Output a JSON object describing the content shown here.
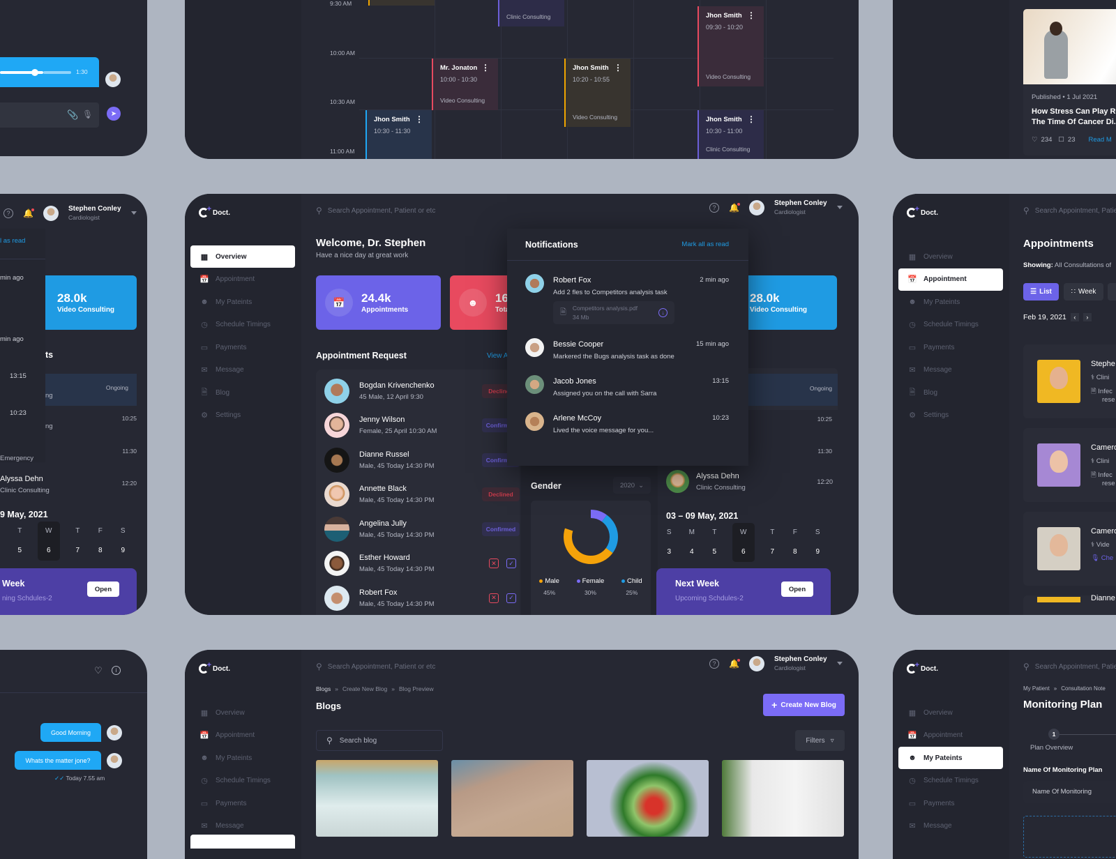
{
  "app": {
    "brand": "Doct."
  },
  "common": {
    "search_placeholder": "Search Appointment, Patient or etc",
    "user_name": "Stephen Conley",
    "user_role": "Cardiologist",
    "nav": [
      "Overview",
      "Appointment",
      "My Pateints",
      "Schedule Timings",
      "Payments",
      "Message",
      "Blog",
      "Settings"
    ]
  },
  "colors": {
    "accent": "#6c63e8",
    "danger": "#e84a5f",
    "info": "#1f9be3",
    "panel": "#262833"
  },
  "schedule_panel": {
    "time_labels": [
      "9:30 AM",
      "10:00 AM",
      "10:30 AM",
      "11:00 AM"
    ],
    "events": [
      {
        "name": "",
        "time": "",
        "kind": "Clinic Consulting",
        "color": "#6c5fd8"
      },
      {
        "name": "Mr. Jonaton",
        "time": "10:00 - 10:30",
        "kind": "Video Consulting",
        "color": "#e84a5f"
      },
      {
        "name": "Jhon Smith",
        "time": "10:20 - 10:55",
        "kind": "Video Consulting",
        "color": "#f0a500"
      },
      {
        "name": "Jhon Smith",
        "time": "09:30 - 10:20",
        "kind": "Video Consulting",
        "color": "#e84a5f"
      },
      {
        "name": "Jhon Smith",
        "time": "10:30 - 11:30",
        "kind": "",
        "color": "#1fa8f5"
      },
      {
        "name": "Jhon Smith",
        "time": "10:30 - 11:00",
        "kind": "Clinic Consulting",
        "color": "#6c5fd8"
      }
    ]
  },
  "chat_top": {
    "audio_duration": "1:30",
    "audio_progress": 0.33
  },
  "blog_card": {
    "published": "Published • 1 Jul 2021",
    "title_line1": "How Stress Can Play Ro",
    "title_line2": "The Time Of Cancer Di.",
    "likes": "234",
    "comments": "23",
    "read_more": "Read M"
  },
  "overview": {
    "welcome": "Welcome, Dr. Stephen",
    "subtitle": "Have a nice day at great work",
    "stats": [
      {
        "value": "24.4k",
        "label": "Appointments",
        "color": "#6c63e8",
        "icon": "calendar-icon"
      },
      {
        "value": "16",
        "label": "Tota",
        "color": "#e84a5f",
        "icon": "user-icon"
      },
      {
        "value": "28.0k",
        "label": "Video Consulting",
        "color": "#1f9be3",
        "icon": "video-icon"
      }
    ],
    "appointment_request": {
      "title": "Appointment Request",
      "view_all": "View A",
      "items": [
        {
          "name": "Bogdan Krivenchenko",
          "sub": "45 Male, 12 April 9:30",
          "status": "Declined"
        },
        {
          "name": "Jenny Wilson",
          "sub": "Female, 25 April 10:30 AM",
          "status": "Confirmed"
        },
        {
          "name": "Dianne Russel",
          "sub": "Male, 45 Today 14:30 PM",
          "status": "Confirmed"
        },
        {
          "name": "Annette Black",
          "sub": "Male, 45 Today 14:30 PM",
          "status": "Declined"
        },
        {
          "name": "Angelina Jully",
          "sub": "Male, 45 Today 14:30 PM",
          "status": "Confirmed"
        },
        {
          "name": "Esther Howard",
          "sub": "Male, 45 Today 14:30 PM",
          "status": "pending"
        },
        {
          "name": "Robert Fox",
          "sub": "Male, 45 Today 14:30 PM",
          "status": "pending"
        }
      ]
    },
    "notifications": {
      "title": "Notifications",
      "mark_all": "Mark all as read",
      "items": [
        {
          "name": "Robert Fox",
          "text": "Add 2 fles to Competitors analysis task",
          "time": "2 min ago",
          "file": {
            "name": "Competitors analysis.pdf",
            "size": "34 Mb"
          }
        },
        {
          "name": "Bessie Cooper",
          "text": "Markered the Bugs analysis task as done",
          "time": "15 min ago"
        },
        {
          "name": "Jacob Jones",
          "text": "Assigned you on the call with Sarra",
          "time": "13:15"
        },
        {
          "name": "Arlene McCoy",
          "text": "Lived the voice message for you...",
          "time": "10:23"
        }
      ]
    },
    "gender": {
      "title": "Gender",
      "year": "2020"
    },
    "upcoming": {
      "title_fragment": "ts",
      "items": [
        {
          "name": "",
          "sub": "ng",
          "time": "Ongoing"
        },
        {
          "name": "",
          "sub": "ng",
          "time": "10:25"
        },
        {
          "name": "",
          "sub": "Emergency",
          "time": "11:30"
        },
        {
          "name": "Alyssa Dehn",
          "sub": "Clinic Consulting",
          "time": "12:20"
        }
      ]
    },
    "week": {
      "range": "03 – 09 May, 2021",
      "days": [
        {
          "d": "S",
          "n": "3"
        },
        {
          "d": "M",
          "n": "4"
        },
        {
          "d": "T",
          "n": "5"
        },
        {
          "d": "W",
          "n": "6"
        },
        {
          "d": "T",
          "n": "7"
        },
        {
          "d": "F",
          "n": "8"
        },
        {
          "d": "S",
          "n": "9"
        }
      ],
      "selected_index": 3
    },
    "next_week": {
      "title": "Next Week",
      "subtitle": "Upcoming Schdules-2",
      "button": "Open"
    }
  },
  "chart_data": {
    "type": "pie",
    "title": "Gender",
    "categories": [
      "Male",
      "Female",
      "Child"
    ],
    "values": [
      45,
      30,
      25
    ],
    "labels": [
      "45%",
      "30%",
      "25%"
    ],
    "colors": [
      "#f5a30a",
      "#7b6cf6",
      "#1f9be3"
    ],
    "donut": true,
    "legend": "bottom"
  },
  "left_middle": {
    "video_value": "28.0k",
    "video_label": "Video Consulting",
    "mark": "l as read",
    "week_title": "Week",
    "week_sub": "ning Schdules-2",
    "range": "9 May, 2021",
    "notif_times": [
      "min ago",
      "min ago",
      "13:15",
      "10:23"
    ]
  },
  "appointments_panel": {
    "title": "Appointments",
    "showing_label": "Showing:",
    "showing_value": "All Consultations of",
    "views": [
      "List",
      "Week"
    ],
    "date": "Feb 19, 2021",
    "cards": [
      {
        "name": "Stephe",
        "kind": "Clini",
        "note": "Infec",
        "note2": "rese"
      },
      {
        "name": "Camero",
        "kind": "Clini",
        "note": "Infec",
        "note2": "rese"
      },
      {
        "name": "Camero",
        "kind": "Vide",
        "note": "Che",
        "note2": ""
      },
      {
        "name": "Dianne",
        "kind": "",
        "note": "",
        "note2": ""
      }
    ]
  },
  "chat_bottom": {
    "messages": [
      "Good Morning",
      "Whats the matter jone?"
    ],
    "status": "Today 7.55 am"
  },
  "blogs_panel": {
    "breadcrumb": [
      "Blogs",
      "Create New Blog",
      "Blog Preview"
    ],
    "title": "Blogs",
    "create_button": "Create New Blog",
    "search_placeholder": "Search blog",
    "filters": "Filters"
  },
  "monitoring_panel": {
    "breadcrumb": [
      "My Patient",
      "Consultation Note"
    ],
    "title": "Monitoring Plan",
    "step_number": "1",
    "step_label": "Plan Overview",
    "field_label": "Name Of Monitoring Plan",
    "field_placeholder": "Name Of Monitoring"
  }
}
